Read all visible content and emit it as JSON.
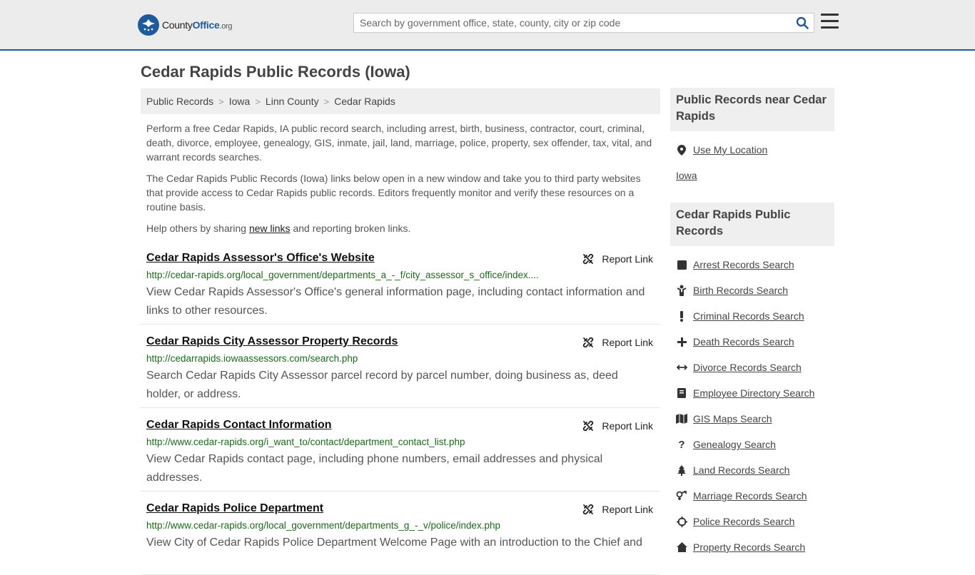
{
  "header": {
    "logo_main": "County",
    "logo_blue": "Office",
    "logo_org": ".org",
    "search_placeholder": "Search by government office, state, county, city or zip code"
  },
  "page_title": "Cedar Rapids Public Records (Iowa)",
  "breadcrumb": [
    "Public Records",
    "Iowa",
    "Linn County",
    "Cedar Rapids"
  ],
  "intro": {
    "p1": "Perform a free Cedar Rapids, IA public record search, including arrest, birth, business, contractor, court, criminal, death, divorce, employee, genealogy, GIS, inmate, jail, land, marriage, police, property, sex offender, tax, vital, and warrant records searches.",
    "p2": "The Cedar Rapids Public Records (Iowa) links below open in a new window and take you to third party websites that provide access to Cedar Rapids public records. Editors frequently monitor and verify these resources on a routine basis.",
    "p3_before": "Help others by sharing ",
    "p3_link": "new links",
    "p3_after": " and reporting broken links."
  },
  "records": [
    {
      "title": "Cedar Rapids Assessor's Office's Website",
      "report": "Report Link",
      "url": "http://cedar-rapids.org/local_government/departments_a_-_f/city_assessor_s_office/index....",
      "desc": "View Cedar Rapids Assessor's Office's general information page, including contact information and links to other resources."
    },
    {
      "title": "Cedar Rapids City Assessor Property Records",
      "report": "Report Link",
      "url": "http://cedarrapids.iowaassessors.com/search.php",
      "desc": "Search Cedar Rapids City Assessor parcel record by parcel number, doing business as, deed holder, or address."
    },
    {
      "title": "Cedar Rapids Contact Information",
      "report": "Report Link",
      "url": "http://www.cedar-rapids.org/i_want_to/contact/department_contact_list.php",
      "desc": "View Cedar Rapids contact page, including phone numbers, email addresses and physical addresses."
    },
    {
      "title": "Cedar Rapids Police Department",
      "report": "Report Link",
      "url": "http://www.cedar-rapids.org/local_government/departments_g_-_v/police/index.php",
      "desc": "View City of Cedar Rapids Police Department Welcome Page with an introduction to the Chief and"
    }
  ],
  "sidebar": {
    "near_title": "Public Records near Cedar Rapids",
    "use_location": "Use My Location",
    "iowa_link": "Iowa",
    "records_title": "Cedar Rapids Public Records",
    "items": [
      {
        "label": "Arrest Records Search",
        "icon": "square-icon"
      },
      {
        "label": "Birth Records Search",
        "icon": "baby-icon"
      },
      {
        "label": "Criminal Records Search",
        "icon": "exclamation-icon"
      },
      {
        "label": "Death Records Search",
        "icon": "cross-icon"
      },
      {
        "label": "Divorce Records Search",
        "icon": "arrows-horizontal-icon"
      },
      {
        "label": "Employee Directory Search",
        "icon": "book-icon"
      },
      {
        "label": "GIS Maps Search",
        "icon": "map-icon"
      },
      {
        "label": "Genealogy Search",
        "icon": "question-icon"
      },
      {
        "label": "Land Records Search",
        "icon": "tree-icon"
      },
      {
        "label": "Marriage Records Search",
        "icon": "gender-icon"
      },
      {
        "label": "Police Records Search",
        "icon": "crosshair-icon"
      },
      {
        "label": "Property Records Search",
        "icon": "home-icon"
      }
    ]
  }
}
